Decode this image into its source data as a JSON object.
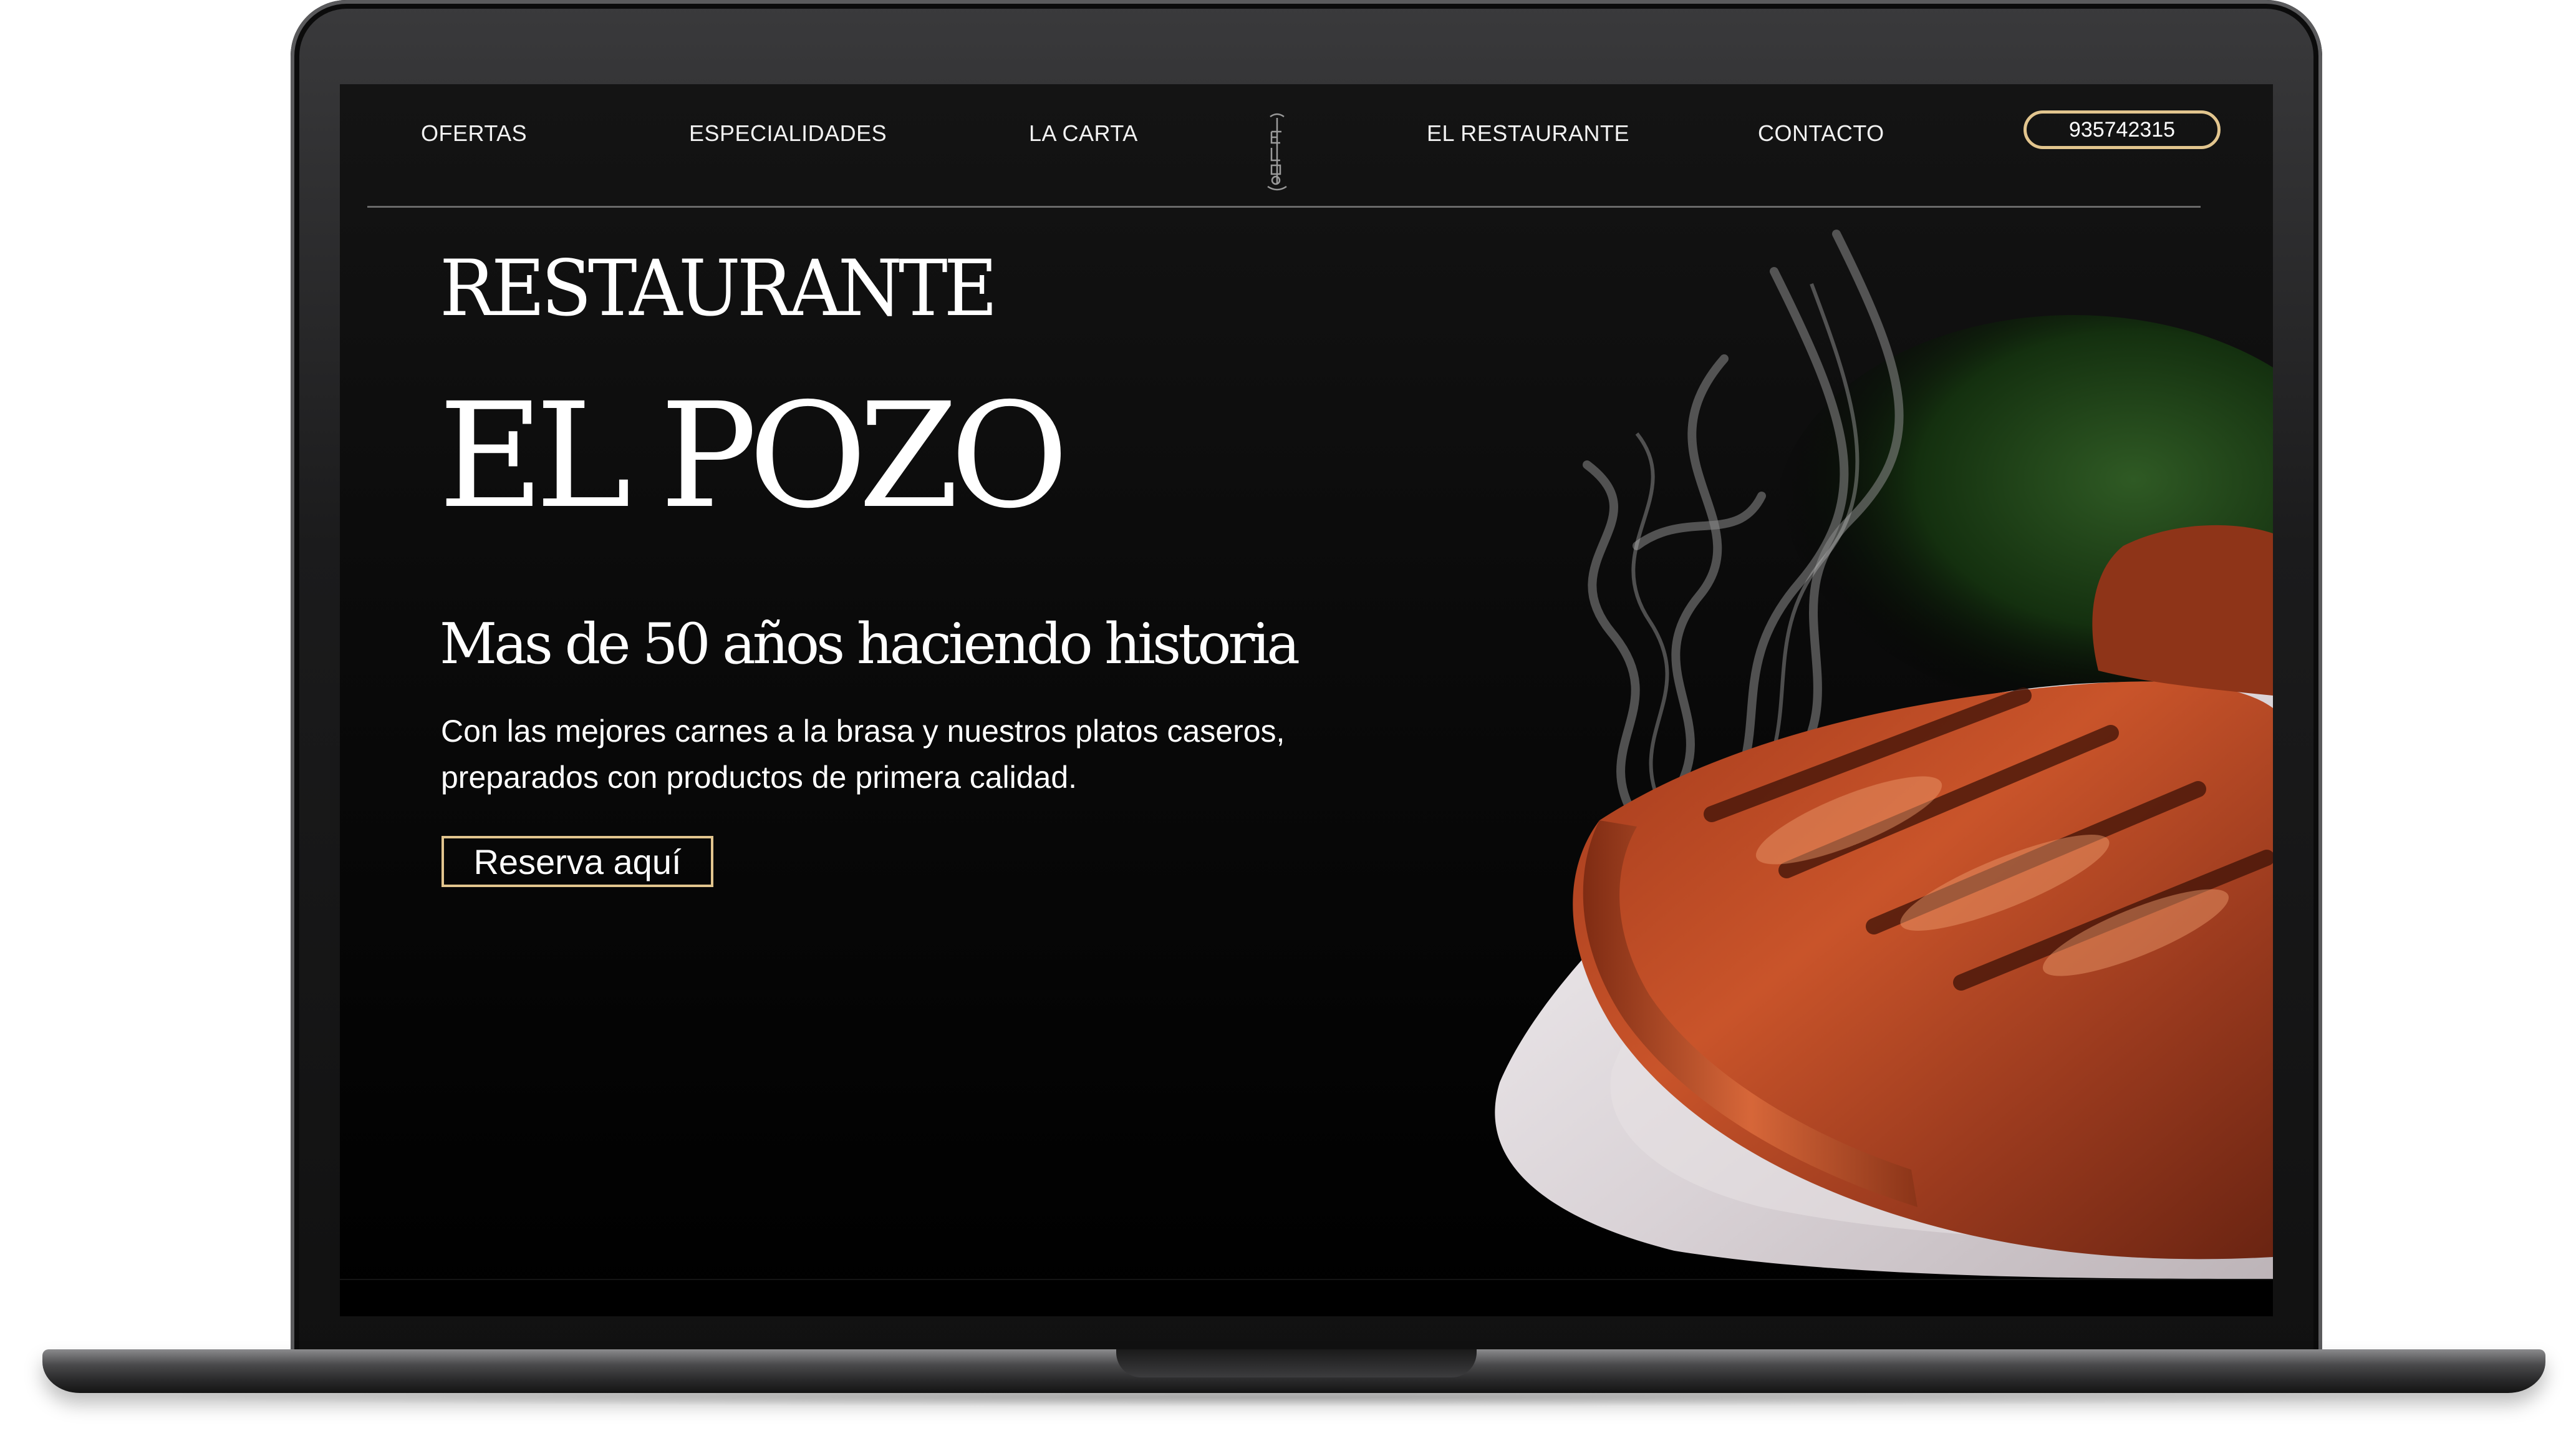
{
  "nav": {
    "items": [
      {
        "label": "OFERTAS"
      },
      {
        "label": "ESPECIALIDADES"
      },
      {
        "label": "LA CARTA"
      },
      {
        "label": "EL RESTAURANTE"
      },
      {
        "label": "CONTACTO"
      }
    ],
    "logo_icon": "el-pozo-vertical-logo-icon",
    "phone": "935742315"
  },
  "hero": {
    "title_line1": "RESTAURANTE",
    "title_line2": "EL POZO",
    "subtitle": "Mas de 50 años haciendo historia",
    "description": "Con las mejores carnes a la brasa y nuestros platos caseros, preparados con productos de primera calidad.",
    "cta": "Reserva aquí",
    "image_icon": "grilled-steak-on-plate-image"
  },
  "colors": {
    "accent_gold": "#e2c58e",
    "background": "#000000",
    "text": "#ffffff"
  }
}
